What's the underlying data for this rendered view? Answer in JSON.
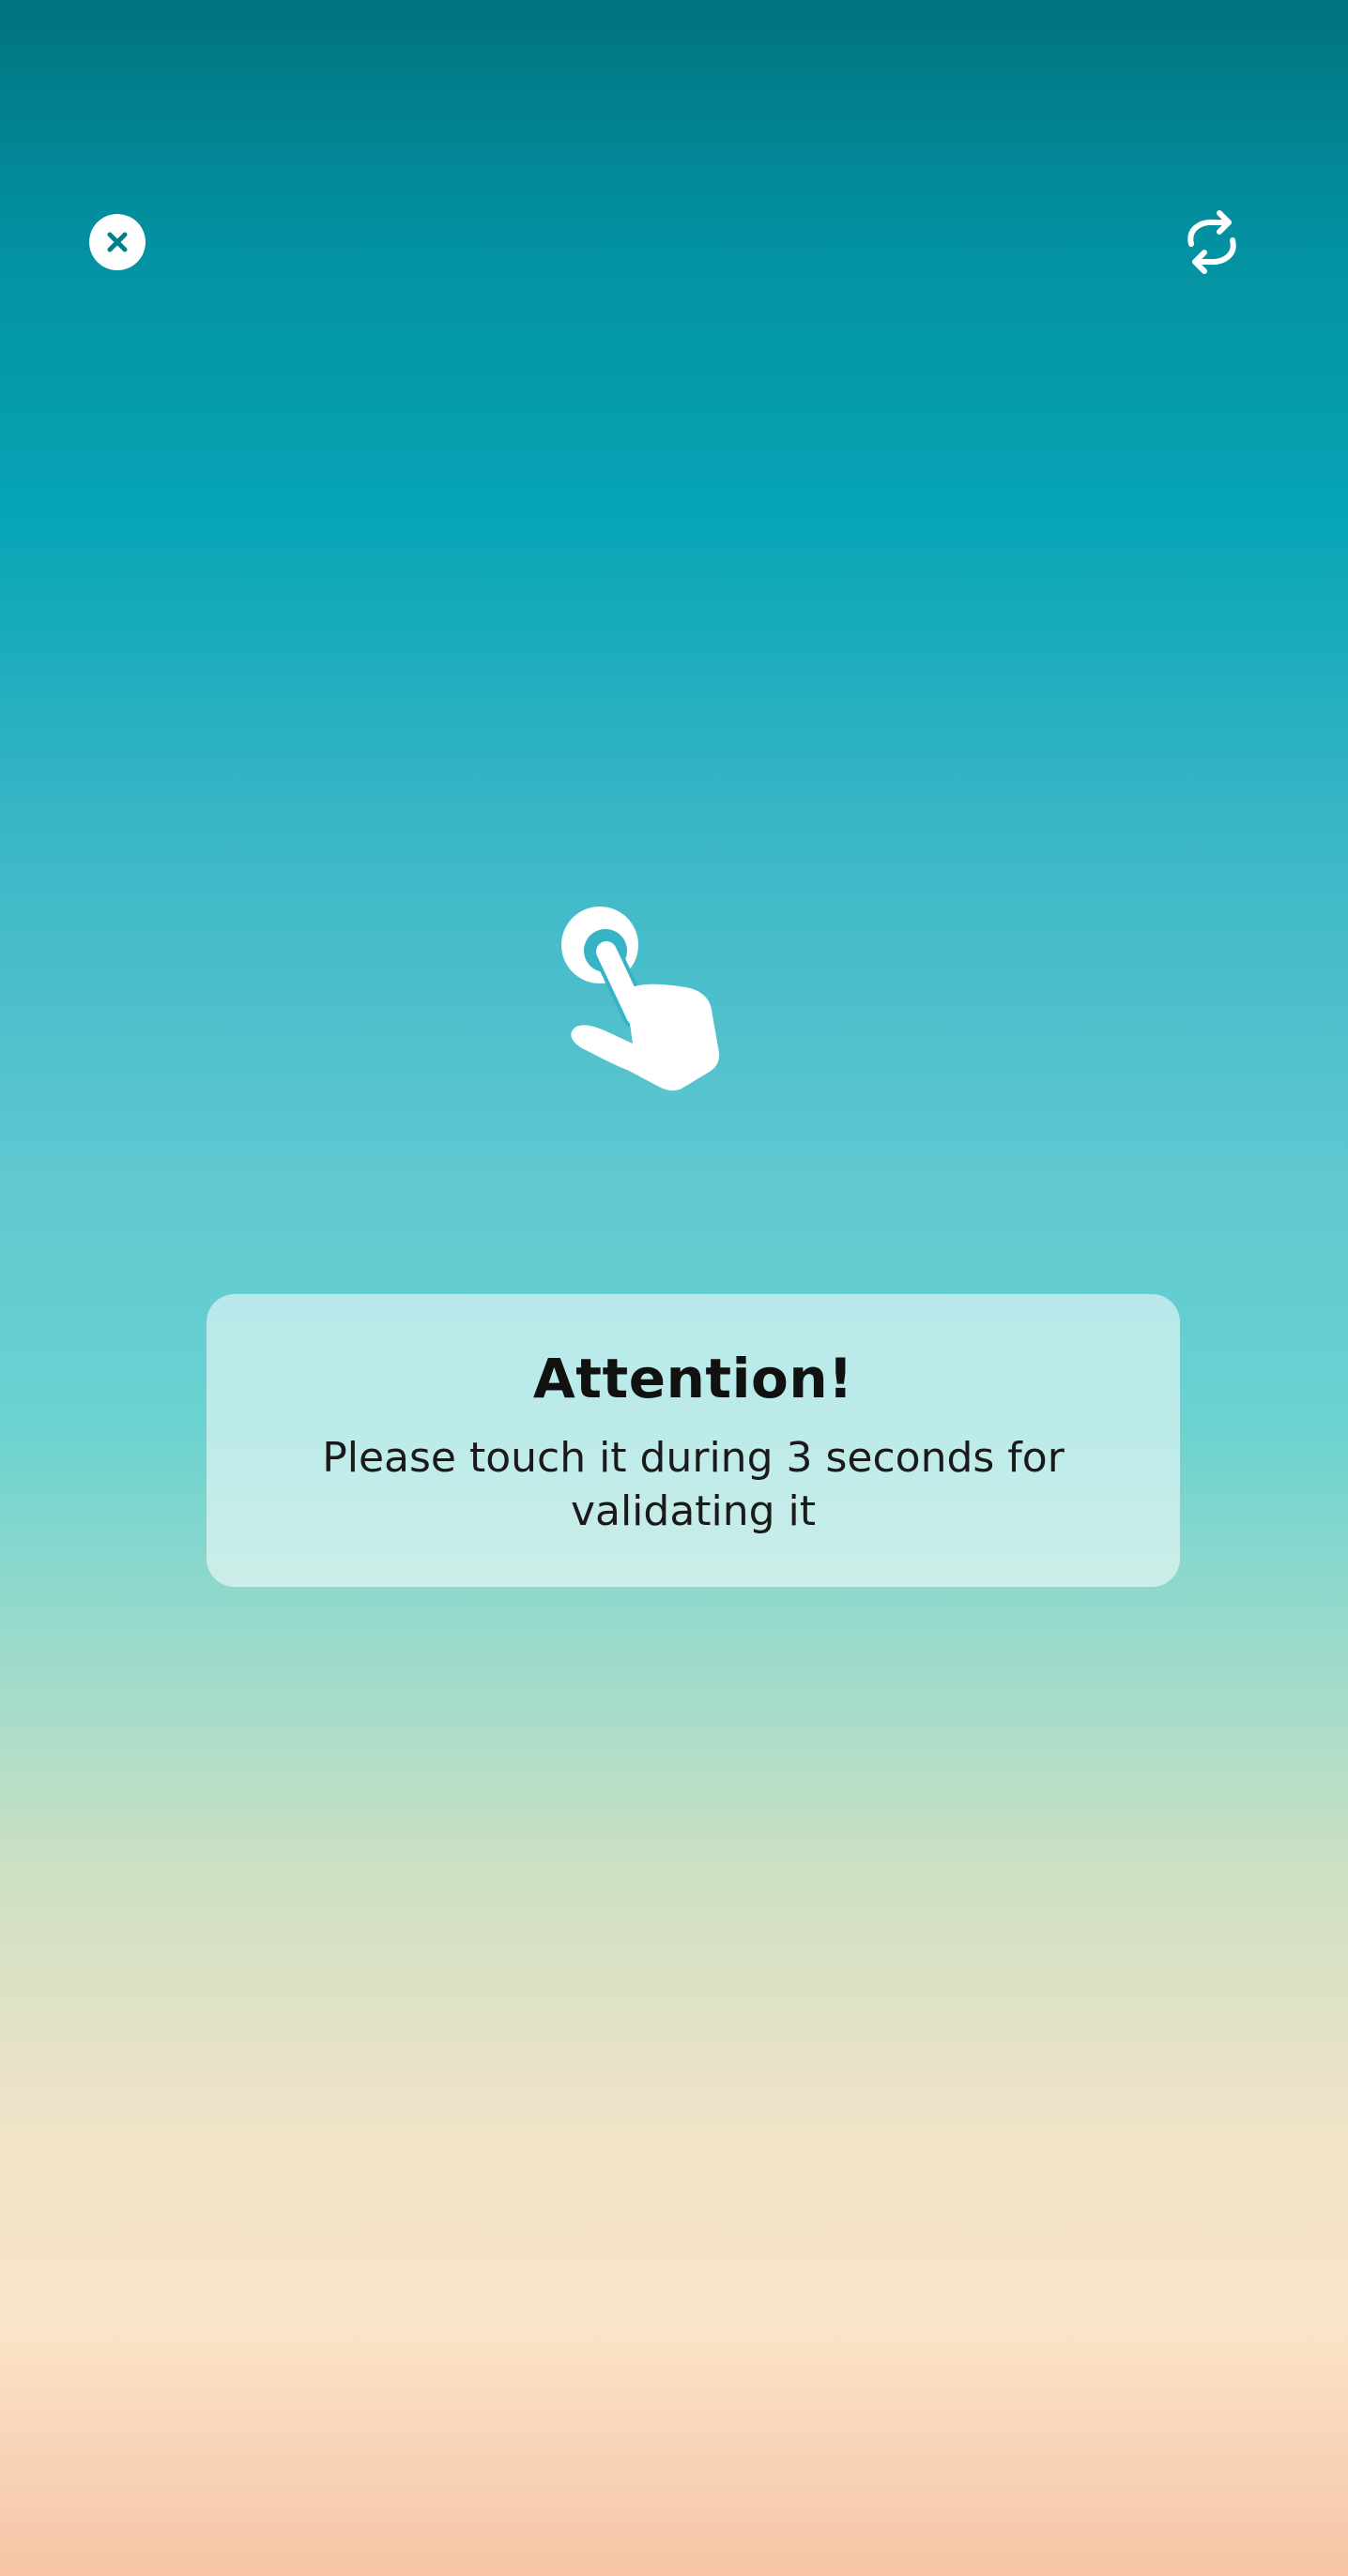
{
  "top_bar": {
    "close_icon": "close-circle-icon",
    "switch_camera_icon": "switch-camera-icon"
  },
  "gesture": {
    "icon": "touch-hand-icon"
  },
  "notice": {
    "title": "Attention!",
    "message": "Please touch it during 3 seconds for validating it"
  },
  "colors": {
    "accent": "#057f8c",
    "gradient_top": "#01737f",
    "gradient_mid": "#6ad2d0",
    "gradient_bottom": "#f7c4a6",
    "icon": "#ffffff"
  }
}
